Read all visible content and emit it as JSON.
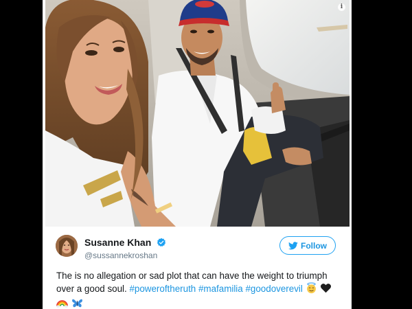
{
  "tweet": {
    "display_name": "Susanne Khan",
    "handle": "@sussannekroshan",
    "follow_label": "Follow",
    "text_before": "The is no allegation or sad plot that can have the weight to triumph over a good soul.",
    "hashtags": [
      "#poweroftheruth",
      "#mafamilia",
      "#goodoverevil"
    ],
    "emojis": [
      "smiling-face-with-halo",
      "black-heart",
      "rainbow",
      "butterfly"
    ]
  },
  "icons": {
    "info": "info-icon",
    "verified": "verified-badge-icon",
    "twitter_bird": "twitter-bird-icon"
  },
  "colors": {
    "twitter_blue": "#1da1f2",
    "link_blue": "#1b95e0",
    "text_dark": "#14171a",
    "text_gray": "#657786"
  }
}
